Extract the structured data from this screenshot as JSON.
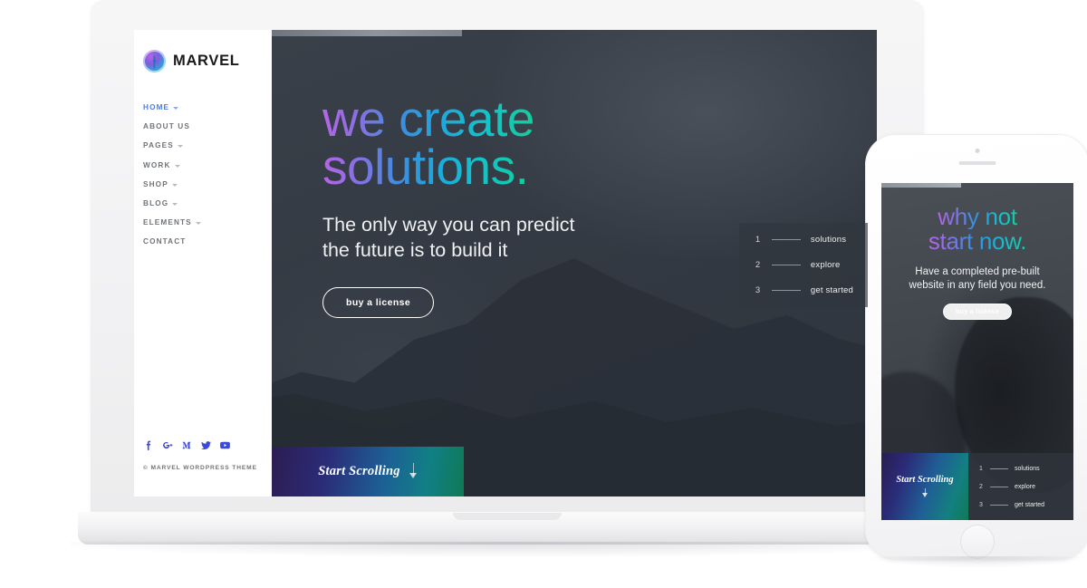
{
  "brand": {
    "name": "MARVEL",
    "logo_icon": "marvel-statue-logo-icon"
  },
  "sidebar": {
    "nav": [
      {
        "label": "HOME",
        "has_caret": true,
        "active": true
      },
      {
        "label": "ABOUT US",
        "has_caret": false,
        "active": false
      },
      {
        "label": "PAGES",
        "has_caret": true,
        "active": false
      },
      {
        "label": "WORK",
        "has_caret": true,
        "active": false
      },
      {
        "label": "SHOP",
        "has_caret": true,
        "active": false
      },
      {
        "label": "BLOG",
        "has_caret": true,
        "active": false
      },
      {
        "label": "ELEMENTS",
        "has_caret": true,
        "active": false
      },
      {
        "label": "CONTACT",
        "has_caret": false,
        "active": false
      }
    ],
    "socials": [
      {
        "name": "facebook-icon"
      },
      {
        "name": "google-plus-icon"
      },
      {
        "name": "medium-icon"
      },
      {
        "name": "twitter-icon"
      },
      {
        "name": "youtube-icon"
      }
    ],
    "copyright": "© MARVEL WORDPRESS THEME"
  },
  "hero": {
    "headline_line1": "we create",
    "headline_line2": "solutions.",
    "subhead_line1": "The only way you can predict",
    "subhead_line2": "the future is to build it",
    "cta_label": "buy a license",
    "steps": [
      {
        "num": "1",
        "label": "solutions"
      },
      {
        "num": "2",
        "label": "explore"
      },
      {
        "num": "3",
        "label": "get started"
      }
    ],
    "scroll_label": "Start Scrolling",
    "scroll_icon": "chevron-down-icon"
  },
  "phone": {
    "headline_line1": "why not",
    "headline_line2": "start now.",
    "subhead_line1": "Have a completed pre-built",
    "subhead_line2": "website in any field you need.",
    "cta_label": "buy a license",
    "scroll_label": "Start Scrolling",
    "steps": [
      {
        "num": "1",
        "label": "solutions"
      },
      {
        "num": "2",
        "label": "explore"
      },
      {
        "num": "3",
        "label": "get started"
      }
    ]
  },
  "colors": {
    "gradient_start": "#b565e8",
    "gradient_mid": "#1fa7dd",
    "gradient_end": "#14cc9e",
    "accent_link": "#4a7ce8",
    "social_blue": "#3b4ad8",
    "hero_bg": "#343a43"
  }
}
